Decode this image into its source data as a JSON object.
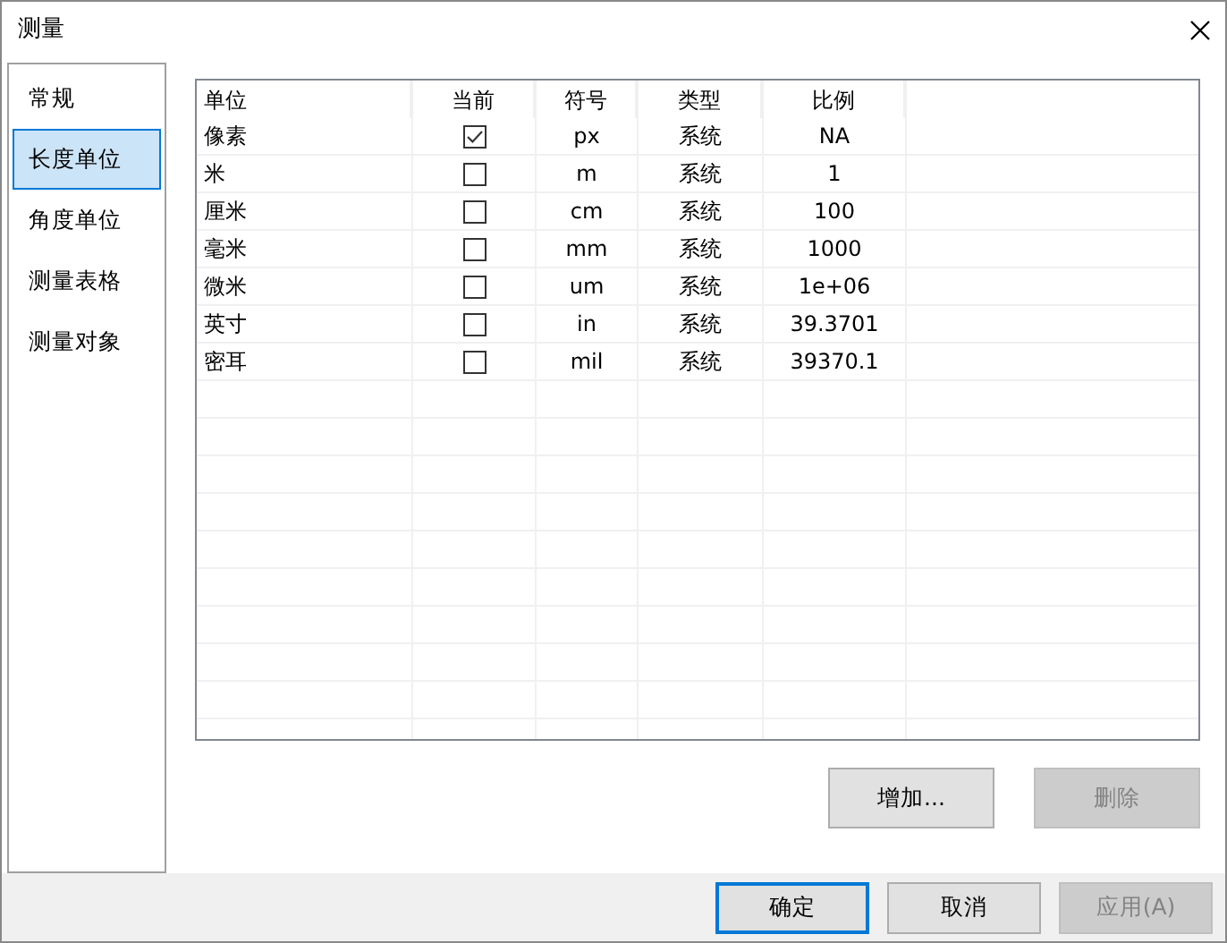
{
  "window": {
    "title": "测量"
  },
  "sidebar": {
    "items": [
      {
        "label": "常规",
        "selected": false
      },
      {
        "label": "长度单位",
        "selected": true
      },
      {
        "label": "角度单位",
        "selected": false
      },
      {
        "label": "测量表格",
        "selected": false
      },
      {
        "label": "测量对象",
        "selected": false
      }
    ]
  },
  "table": {
    "columns": [
      "单位",
      "当前",
      "符号",
      "类型",
      "比例"
    ],
    "rows": [
      {
        "unit": "像素",
        "checked": true,
        "symbol": "px",
        "type": "系统",
        "ratio": "NA"
      },
      {
        "unit": "米",
        "checked": false,
        "symbol": "m",
        "type": "系统",
        "ratio": "1"
      },
      {
        "unit": "厘米",
        "checked": false,
        "symbol": "cm",
        "type": "系统",
        "ratio": "100"
      },
      {
        "unit": "毫米",
        "checked": false,
        "symbol": "mm",
        "type": "系统",
        "ratio": "1000"
      },
      {
        "unit": "微米",
        "checked": false,
        "symbol": "um",
        "type": "系统",
        "ratio": "1e+06"
      },
      {
        "unit": "英寸",
        "checked": false,
        "symbol": "in",
        "type": "系统",
        "ratio": "39.3701"
      },
      {
        "unit": "密耳",
        "checked": false,
        "symbol": "mil",
        "type": "系统",
        "ratio": "39370.1"
      }
    ]
  },
  "table_buttons": [
    {
      "label": "增加...",
      "disabled": false
    },
    {
      "label": "删除",
      "disabled": true
    }
  ],
  "dialog_buttons": [
    {
      "label": "确定",
      "disabled": false,
      "default": true
    },
    {
      "label": "取消",
      "disabled": false,
      "default": false
    },
    {
      "label": "应用(A)",
      "disabled": true,
      "default": false
    }
  ]
}
